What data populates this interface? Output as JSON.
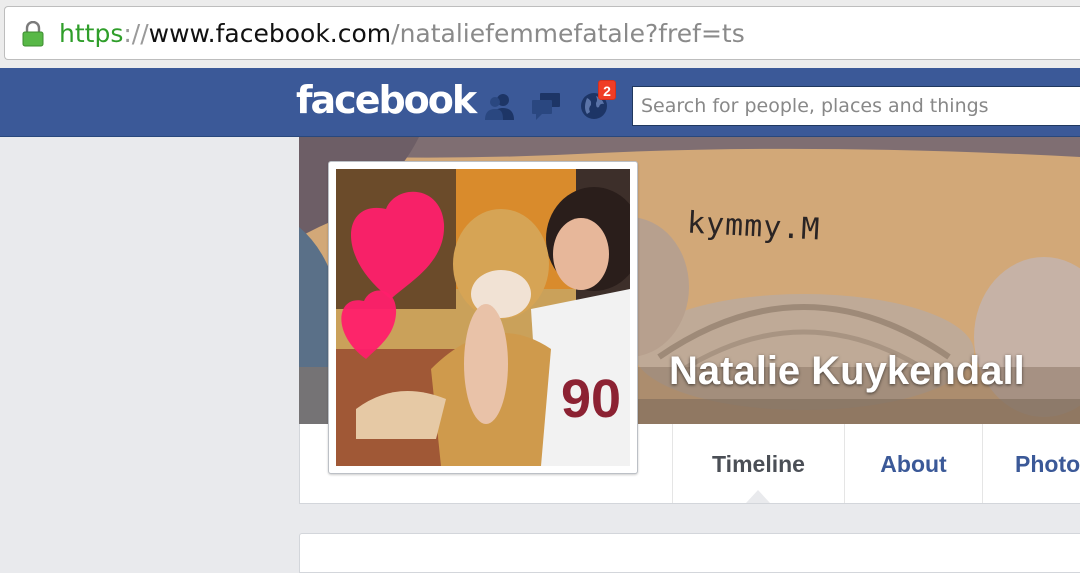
{
  "browser": {
    "url_scheme": "https",
    "url_separator": "://",
    "url_host": "www.facebook.com",
    "url_path": "/nataliefemmefatale?fref=ts"
  },
  "header": {
    "logo": "facebook",
    "notifications_badge": "2",
    "search_placeholder": "Search for people, places and things",
    "icons": [
      "friends-icon",
      "messages-icon",
      "notifications-globe-icon"
    ]
  },
  "profile": {
    "name": "Natalie Kuykendall",
    "cover_signature": "kymmy.M"
  },
  "tabs": [
    {
      "label": "Timeline",
      "active": true
    },
    {
      "label": "About",
      "active": false
    },
    {
      "label": "Photo",
      "active": false
    }
  ],
  "colors": {
    "brand_blue": "#3b5998",
    "badge_red": "#f03d25",
    "url_green": "#2f9e2a"
  }
}
